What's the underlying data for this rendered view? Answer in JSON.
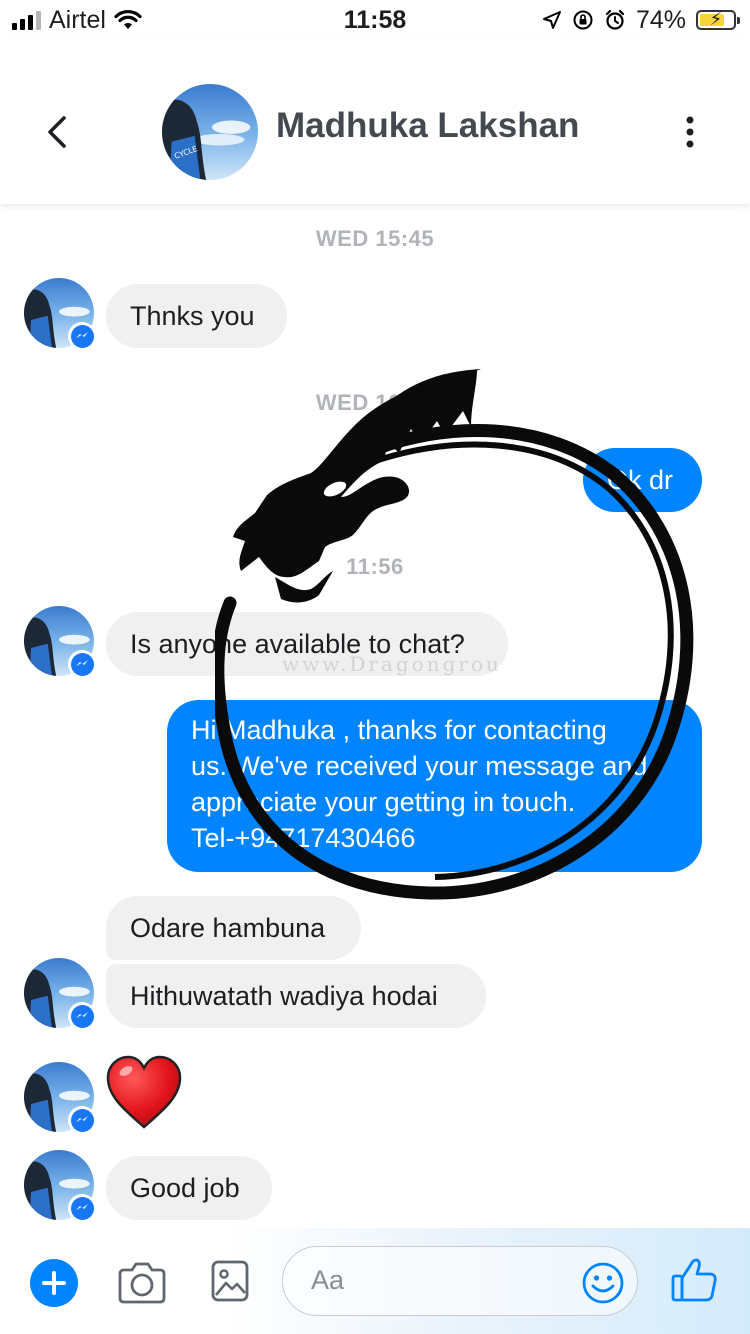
{
  "status_bar": {
    "carrier": "Airtel",
    "time": "11:58",
    "battery_percent": "74%",
    "battery_level": 0.74,
    "icons": [
      "signal-icon",
      "wifi-icon",
      "location-icon",
      "orientation-lock-icon",
      "alarm-icon",
      "battery-charging-icon"
    ]
  },
  "header": {
    "contact_name": "Madhuka Lakshan",
    "icons": [
      "back-chevron-icon",
      "more-vertical-icon"
    ]
  },
  "conversation": {
    "timestamps": [
      "WED 15:45",
      "WED 16:38",
      "11:56"
    ],
    "messages": [
      {
        "from": "contact",
        "text": "Thnks you"
      },
      {
        "from": "me",
        "text": "Ok dr"
      },
      {
        "from": "contact",
        "text": "Is anyone available to chat?"
      },
      {
        "from": "me",
        "lines": [
          "Hi Madhuka , thanks for contacting",
          "us. We've received your message and",
          "appreciate your getting in touch.",
          "Tel-+94717430466"
        ]
      },
      {
        "from": "contact",
        "text": "Odare hambuna"
      },
      {
        "from": "contact",
        "text": "Hithuwatath wadiya hodai"
      },
      {
        "from": "contact",
        "emoji": "heart"
      },
      {
        "from": "contact",
        "text": "Good job"
      }
    ]
  },
  "watermark": {
    "text": "www.Dragongrou"
  },
  "composer": {
    "placeholder": "Aa",
    "icons": [
      "plus-icon",
      "camera-icon",
      "image-icon",
      "emoji-icon",
      "thumbs-up-icon"
    ]
  },
  "colors": {
    "accent": "#0084ff",
    "incoming_bubble": "#f0f0f0",
    "timestamp": "#b0b3b8",
    "name": "#444950"
  }
}
